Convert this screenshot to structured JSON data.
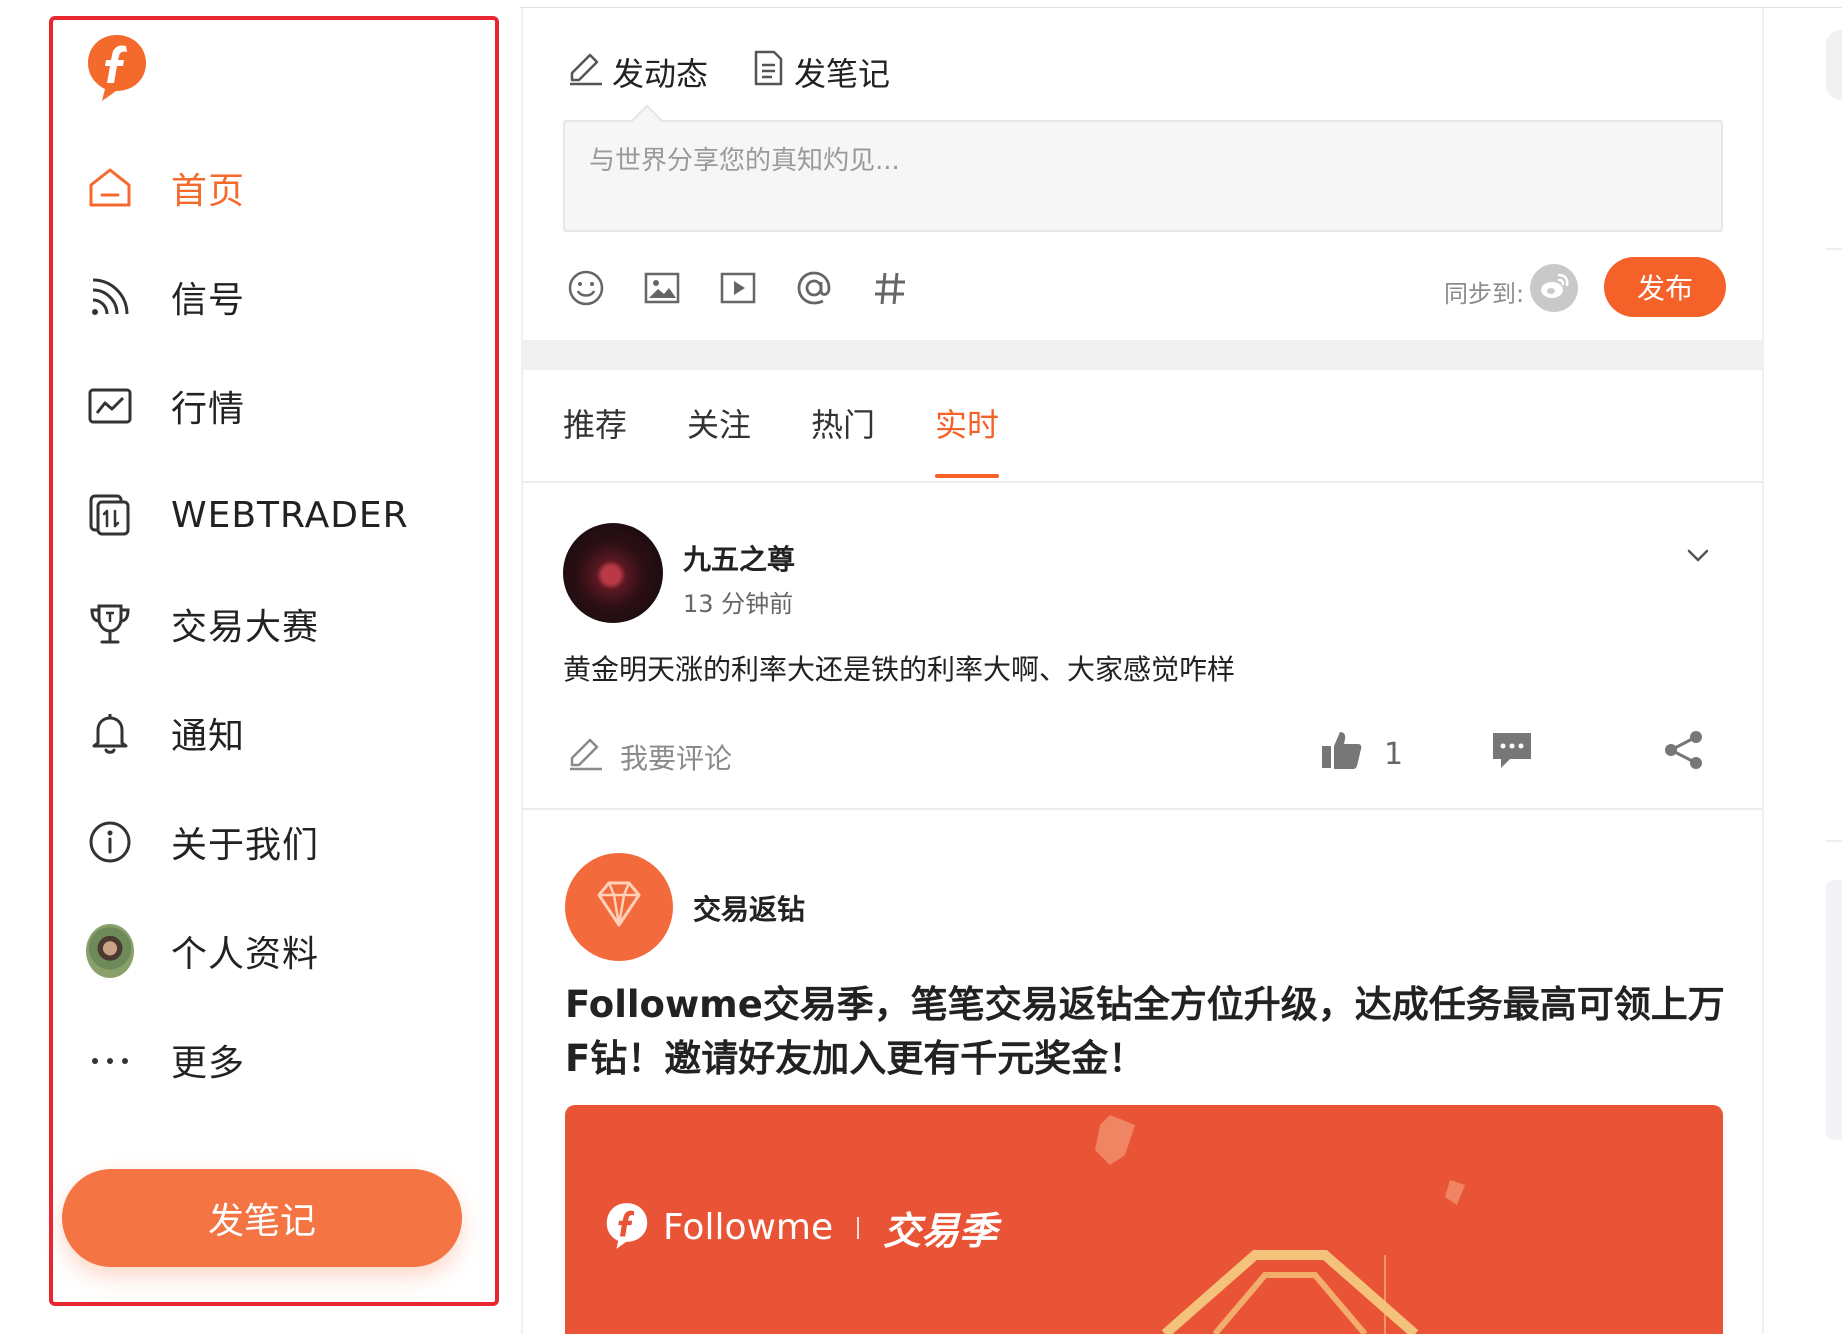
{
  "sidebar": {
    "logo": "followme-logo",
    "items": [
      {
        "label": "首页",
        "icon": "home-icon",
        "active": true
      },
      {
        "label": "信号",
        "icon": "signal-icon"
      },
      {
        "label": "行情",
        "icon": "chart-icon"
      },
      {
        "label": "WEBTRADER",
        "icon": "webtrader-icon"
      },
      {
        "label": "交易大赛",
        "icon": "trophy-icon"
      },
      {
        "label": "通知",
        "icon": "bell-icon"
      },
      {
        "label": "关于我们",
        "icon": "info-icon"
      },
      {
        "label": "个人资料",
        "icon": "avatar"
      },
      {
        "label": "更多",
        "icon": "more-icon"
      }
    ],
    "cta_label": "发笔记",
    "highlight_color": "#e8262f"
  },
  "composer": {
    "tabs": [
      {
        "label": "发动态",
        "icon": "edit-icon"
      },
      {
        "label": "发笔记",
        "icon": "note-icon"
      }
    ],
    "placeholder": "与世界分享您的真知灼见...",
    "tools": [
      "emoji-icon",
      "image-icon",
      "video-icon",
      "at-icon",
      "hashtag-icon"
    ],
    "sync_label": "同步到:",
    "sync_target": "weibo-icon",
    "publish_label": "发布"
  },
  "feed": {
    "tabs": [
      "推荐",
      "关注",
      "热门",
      "实时"
    ],
    "active_tab": "实时",
    "posts": [
      {
        "author": "九五之尊",
        "time": "13 分钟前",
        "text": "黄金明天涨的利率大还是铁的利率大啊、大家感觉咋样",
        "comment_placeholder": "我要评论",
        "likes": "1"
      },
      {
        "author": "交易返钻",
        "title": "Followme交易季，笔笔交易返钻全方位升级，达成任务最高可领上万F钻！邀请好友加入更有千元奖金！",
        "banner_brand": "Followme",
        "banner_title": "交易季"
      }
    ]
  },
  "colors": {
    "accent": "#f4622a",
    "cta": "#f47443",
    "banner": "#ea5436"
  }
}
